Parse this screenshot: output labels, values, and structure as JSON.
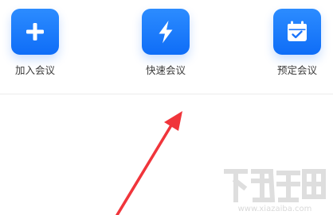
{
  "actions": [
    {
      "label": "加入会议",
      "icon": "plus-icon"
    },
    {
      "label": "快速会议",
      "icon": "lightning-icon"
    },
    {
      "label": "预定会议",
      "icon": "calendar-check-icon"
    }
  ],
  "watermark": {
    "url": "www.xiazaiba.com"
  },
  "colors": {
    "accent": "#1677ff",
    "annotation_arrow": "#f0353b",
    "label_text": "#3a3a3a",
    "watermark": "#d9d9d9"
  }
}
